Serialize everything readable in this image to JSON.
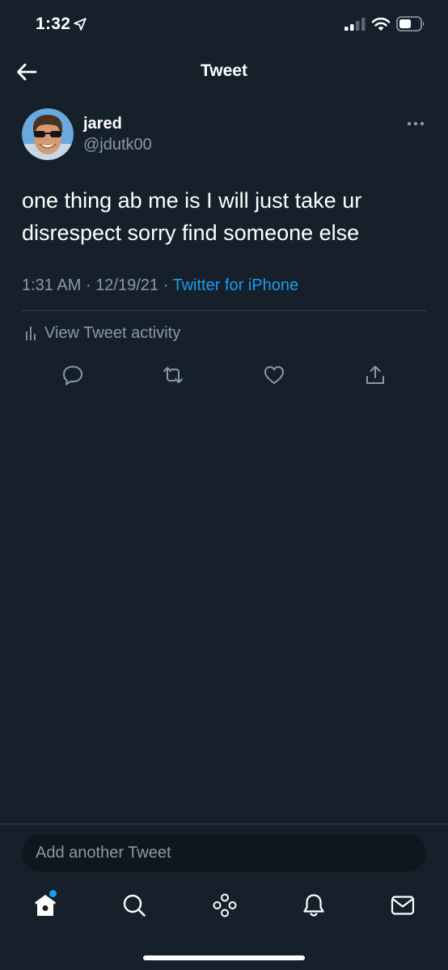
{
  "status_bar": {
    "time": "1:32",
    "icons": [
      "location-arrow-icon",
      "cellular-signal-icon",
      "wifi-icon",
      "battery-icon"
    ]
  },
  "header": {
    "title": "Tweet",
    "back_icon": "back-arrow-icon"
  },
  "tweet": {
    "author": {
      "name": "jared",
      "handle": "@jdutk00"
    },
    "text": "one thing ab me is I will just take ur disrespect sorry find someone else",
    "time": "1:31 AM",
    "date": "12/19/21",
    "separator": "·",
    "source": "Twitter for iPhone",
    "activity_label": "View Tweet activity",
    "actions": [
      "reply-icon",
      "retweet-icon",
      "like-icon",
      "share-icon"
    ]
  },
  "composer": {
    "placeholder": "Add another Tweet"
  },
  "tab_bar": {
    "items": [
      "home-icon",
      "search-icon",
      "spaces-icon",
      "notifications-icon",
      "messages-icon"
    ],
    "home_has_badge": true
  },
  "colors": {
    "background": "#15202b",
    "text": "#ffffff",
    "secondary_text": "#8b98a5",
    "accent": "#1d9bf0",
    "divider": "#38444d",
    "composer_bg": "#0f161d"
  }
}
